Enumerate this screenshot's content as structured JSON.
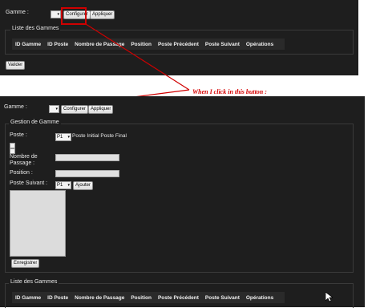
{
  "top_panel": {
    "gamme_label": "Gamme :",
    "gamme_select_value": "",
    "configurer_label": "Configurer",
    "appliquer_label": "Appliquer",
    "liste_legend": "Liste des Gammes",
    "columns": [
      "ID Gamme",
      "ID Poste",
      "Nombre de Passage",
      "Position",
      "Poste Précédent",
      "Poste Suivant",
      "Opérations"
    ],
    "valider_label": "Valider"
  },
  "annotation": {
    "text": "When I click in this button :",
    "color": "#d40000"
  },
  "bottom_panel": {
    "gamme_label": "Gamme :",
    "gamme_select_value": "",
    "configurer_label": "Configurer",
    "appliquer_label": "Appliquer",
    "gestion_legend": "Gestion de Gamme",
    "poste_label": "Poste :",
    "poste_select_value": "P1",
    "poste_initial_final": "Poste Initial Poste Final",
    "nombre_label_line1": "Nombre de",
    "nombre_label_line2": "Passage :",
    "position_label": "Position :",
    "poste_suivant_label": "Poste Suivant :",
    "poste_suivant_select_value": "P1",
    "ajouter_label": "Ajouter",
    "enregistrer_label": "Enregistrer",
    "liste_legend": "Liste des Gammes",
    "columns": [
      "ID Gamme",
      "ID Poste",
      "Nombre de Passage",
      "Position",
      "Poste Précédent",
      "Poste Suivant",
      "Opérations"
    ]
  },
  "icons": {
    "cursor": "mouse-pointer-icon",
    "caret": "chevron-down-icon"
  }
}
